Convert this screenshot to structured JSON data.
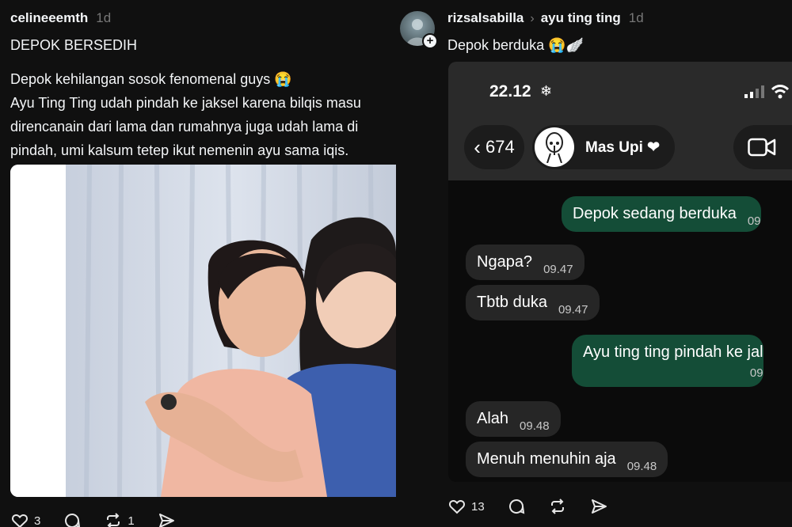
{
  "left_post": {
    "username": "celineeemth",
    "time": "1d",
    "title": "DEPOK BERSEDIH",
    "body_lines": [
      "Depok kehilangan sosok fenomenal guys 😭",
      "Ayu Ting Ting udah pindah ke jaksel karena bilqis masu",
      "direncanain dari lama dan rumahnya juga udah lama di",
      "pindah, umi kalsum tetep ikut nemenin ayu sama iqis."
    ],
    "like_count": "3",
    "repost_count": "1"
  },
  "right_post": {
    "username": "rizsalsabilla",
    "reply_to": "ayu ting ting",
    "time": "1d",
    "caption": "Depok berduka 😭🪽",
    "like_count": "13",
    "screenshot": {
      "clock": "22.12",
      "back_count": "674",
      "contact_name": "Mas Upi ❤",
      "messages": [
        {
          "dir": "out",
          "text": "Depok sedang berduka",
          "time": "09"
        },
        {
          "dir": "in",
          "text": "Ngapa?",
          "time": "09.47"
        },
        {
          "dir": "in",
          "text": "Tbtb duka",
          "time": "09.47"
        },
        {
          "dir": "out",
          "text": "Ayu ting ting pindah ke jal",
          "time": "09"
        },
        {
          "dir": "in",
          "text": "Alah",
          "time": "09.48"
        },
        {
          "dir": "in",
          "text": "Menuh menuhin aja",
          "time": "09.48"
        }
      ]
    }
  },
  "colors": {
    "background": "#101010",
    "outgoing_bubble": "#144d37",
    "incoming_bubble": "#262626",
    "muted_text": "#777777"
  },
  "icons": [
    "heart-icon",
    "comment-icon",
    "repost-icon",
    "share-icon",
    "chevron-right-icon",
    "snowflake-icon",
    "video-icon"
  ]
}
